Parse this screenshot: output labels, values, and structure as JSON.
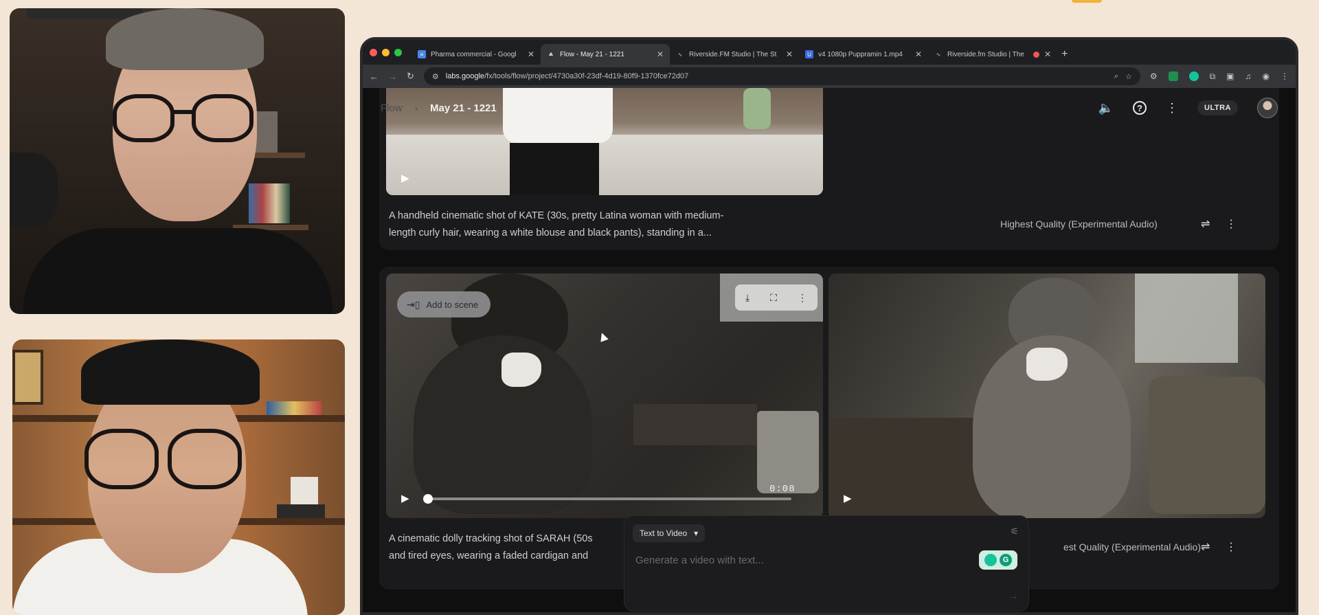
{
  "browser": {
    "tabs": [
      {
        "label": "Pharma commercial - Googl",
        "favicon": "docs-icon",
        "color": "#4a86e8",
        "active": false
      },
      {
        "label": "Flow - May 21 - 1221",
        "favicon": "flow-icon",
        "color": "#9aa0a6",
        "active": true
      },
      {
        "label": "Riverside.FM Studio | The St",
        "favicon": "riverside-icon",
        "color": "#8f8f8f",
        "active": false
      },
      {
        "label": "v4 1080p Puppramin 1.mp4",
        "favicon": "video-icon",
        "color": "#3c6ae0",
        "active": false
      },
      {
        "label": "Riverside.fm Studio | The",
        "favicon": "riverside-icon",
        "color": "#8f8f8f",
        "active": false
      }
    ],
    "url_host": "labs.google",
    "url_path": "/fx/tools/flow/project/4730a30f-23df-4d19-80f9-1370fce72d07"
  },
  "app": {
    "breadcrumb_parent": "Flow",
    "title": "May 21 - 1221",
    "plan_badge": "ULTRA"
  },
  "clips": [
    {
      "description_line1": "A handheld cinematic shot of KATE (30s, pretty Latina woman with medium-",
      "description_line2": "length curly hair, wearing a white blouse and black pants), standing in a...",
      "quality": "Highest Quality (Experimental Audio)"
    },
    {
      "add_to_scene": "Add to scene",
      "time": "0:08",
      "progress": 0.0,
      "description_line1": "A cinematic dolly tracking shot of SARAH (50s",
      "description_line2": "and tired eyes, wearing a faded cardigan and",
      "quality": "est Quality (Experimental Audio)"
    }
  ],
  "composer": {
    "mode": "Text to Video",
    "placeholder": "Generate a video with text..."
  }
}
